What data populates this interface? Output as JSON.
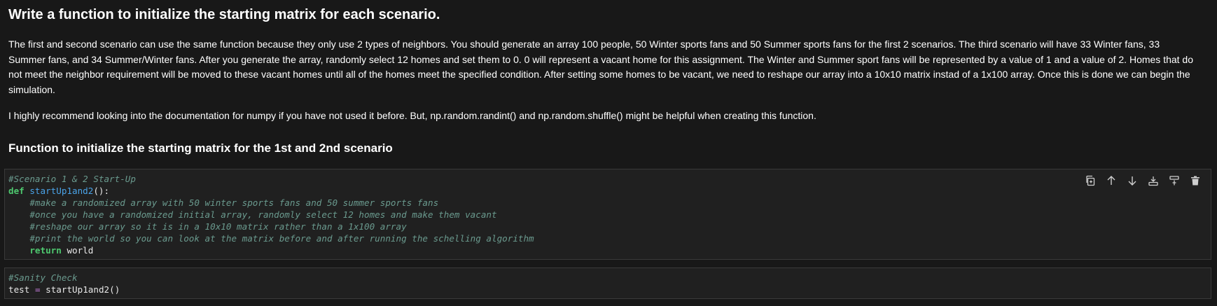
{
  "markdown": {
    "heading": "Write a function to initialize the starting matrix for each scenario.",
    "paragraph1": "The first and second scenario can use the same function because they only use 2 types of neighbors. You should generate an array 100 people, 50 Winter sports fans and 50 Summer sports fans for the first 2 scenarios. The third scenario will have 33 Winter fans, 33 Summer fans, and 34 Summer/Winter fans. After you generate the array, randomly select 12 homes and set them to 0. 0 will represent a vacant home for this assignment. The Winter and Summer sport fans will be represented by a value of 1 and a value of 2. Homes that do not meet the neighbor requirement will be moved to these vacant homes until all of the homes meet the specified condition. After setting some homes to be vacant, we need to reshape our array into a 10x10 matrix instad of a 1x100 array. Once this is done we can begin the simulation.",
    "paragraph2": "I highly recommend looking into the documentation for numpy if you have not used it before. But, np.random.randint() and np.random.shuffle() might be helpful when creating this function.",
    "subheading": "Function to initialize the starting matrix for the 1st and 2nd scenario"
  },
  "cell1": {
    "line1_comment": "#Scenario 1 & 2 Start-Up",
    "line2_kw": "def",
    "line2_fn": "startUp1and2",
    "line2_rest": "():",
    "line3_comment": "#make a randomized array with 50 winter sports fans and 50 summer sports fans",
    "line4_comment": "#once you have a randomized initial array, randomly select 12 homes and make them vacant",
    "line5_comment": "#reshape our array so it is in a 10x10 matrix rather than a 1x100 array",
    "line6_comment": "#print the world so you can look at the matrix before and after running the schelling algorithm",
    "line7_kw": "return",
    "line7_rest": "world"
  },
  "cell2": {
    "line1_comment": "#Sanity Check",
    "line2_var": "test",
    "line2_op": "=",
    "line2_call": "startUp1and2()"
  },
  "toolbar": {
    "icons": [
      "copy-icon",
      "arrow-up-icon",
      "arrow-down-icon",
      "insert-below-icon",
      "split-cell-icon",
      "trash-icon"
    ]
  }
}
